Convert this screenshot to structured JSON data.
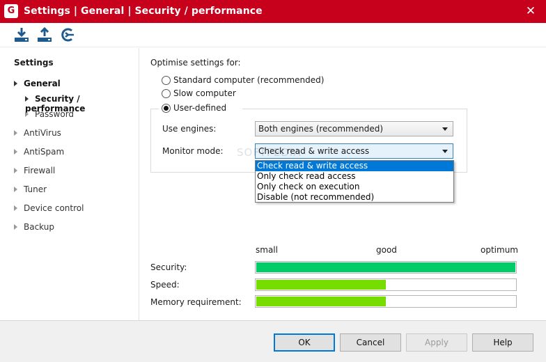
{
  "window": {
    "logo_letter": "G",
    "title": "Settings | General | Security / performance",
    "close_glyph": "✕",
    "accent_color": "#c7001b"
  },
  "toolbar": {
    "icons": [
      "import-icon",
      "export-icon",
      "reset-icon"
    ],
    "icon_color": "#1f5a8f"
  },
  "sidebar": {
    "heading": "Settings",
    "items": [
      {
        "label": "General"
      },
      {
        "label": "Security / performance"
      },
      {
        "label": "Password"
      },
      {
        "label": "AntiVirus"
      },
      {
        "label": "AntiSpam"
      },
      {
        "label": "Firewall"
      },
      {
        "label": "Tuner"
      },
      {
        "label": "Device control"
      },
      {
        "label": "Backup"
      }
    ]
  },
  "main": {
    "optimise_label": "Optimise settings for:",
    "radios": [
      {
        "label": "Standard computer (recommended)",
        "checked": false
      },
      {
        "label": "Slow computer",
        "checked": false
      },
      {
        "label": "User-defined",
        "checked": true
      }
    ],
    "engines_label": "Use engines:",
    "engines_value": "Both engines (recommended)",
    "monitor_label": "Monitor mode:",
    "monitor_value": "Check read & write access",
    "monitor_options": [
      "Check read & write access",
      "Only check read access",
      "Only check on execution",
      "Disable (not recommended)"
    ],
    "watermark": "SOFTPEDIA"
  },
  "scale": {
    "small": "small",
    "good": "good",
    "optimum": "optimum"
  },
  "bars": [
    {
      "label": "Security:",
      "level": 1.0,
      "color": "#00cc66"
    },
    {
      "label": "Speed:",
      "level": 0.5,
      "color": "#77dd00"
    },
    {
      "label": "Memory requirement:",
      "level": 0.5,
      "color": "#77dd00"
    }
  ],
  "buttons": {
    "ok": "OK",
    "cancel": "Cancel",
    "apply": "Apply",
    "help": "Help"
  }
}
